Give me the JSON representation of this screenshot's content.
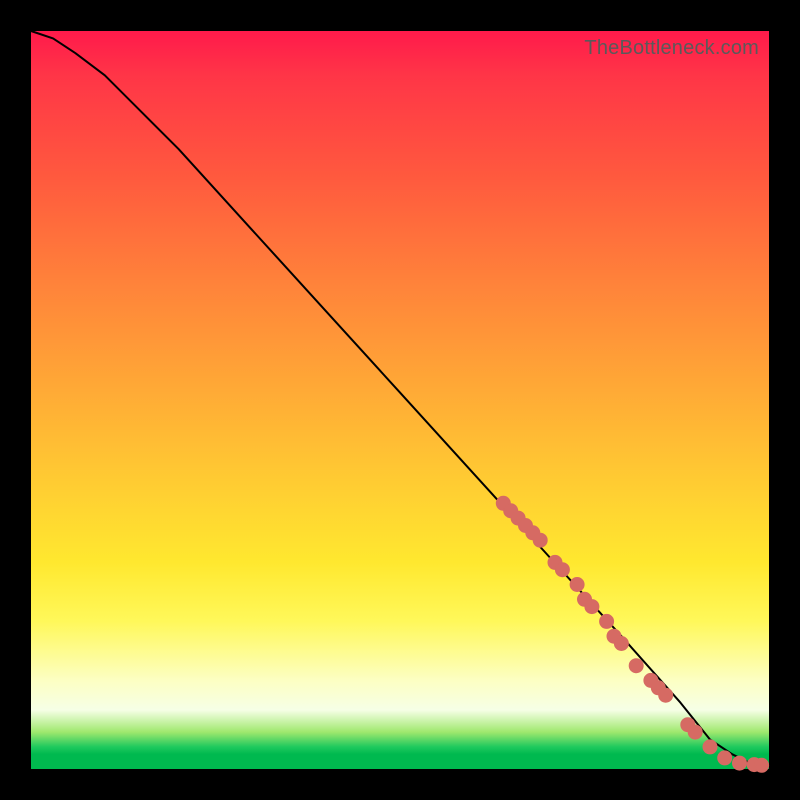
{
  "watermark": "TheBottleneck.com",
  "chart_data": {
    "type": "line",
    "title": "",
    "xlabel": "",
    "ylabel": "",
    "xlim": [
      0,
      100
    ],
    "ylim": [
      0,
      100
    ],
    "series": [
      {
        "name": "curve",
        "x": [
          0,
          3,
          6,
          10,
          15,
          20,
          30,
          40,
          50,
          60,
          70,
          80,
          88,
          92,
          95,
          97,
          99,
          100
        ],
        "y": [
          100,
          99,
          97,
          94,
          89,
          84,
          73,
          62,
          51,
          40,
          29,
          18,
          9,
          4,
          2,
          1,
          0.5,
          0.5
        ]
      }
    ],
    "scatter": {
      "name": "highlighted-points",
      "color": "#d66a63",
      "points": [
        {
          "x": 64,
          "y": 36
        },
        {
          "x": 65,
          "y": 35
        },
        {
          "x": 66,
          "y": 34
        },
        {
          "x": 67,
          "y": 33
        },
        {
          "x": 68,
          "y": 32
        },
        {
          "x": 69,
          "y": 31
        },
        {
          "x": 71,
          "y": 28
        },
        {
          "x": 72,
          "y": 27
        },
        {
          "x": 74,
          "y": 25
        },
        {
          "x": 75,
          "y": 23
        },
        {
          "x": 76,
          "y": 22
        },
        {
          "x": 78,
          "y": 20
        },
        {
          "x": 79,
          "y": 18
        },
        {
          "x": 80,
          "y": 17
        },
        {
          "x": 82,
          "y": 14
        },
        {
          "x": 84,
          "y": 12
        },
        {
          "x": 85,
          "y": 11
        },
        {
          "x": 86,
          "y": 10
        },
        {
          "x": 89,
          "y": 6
        },
        {
          "x": 90,
          "y": 5
        },
        {
          "x": 92,
          "y": 3
        },
        {
          "x": 94,
          "y": 1.5
        },
        {
          "x": 96,
          "y": 0.8
        },
        {
          "x": 98,
          "y": 0.6
        },
        {
          "x": 99,
          "y": 0.5
        }
      ]
    }
  }
}
